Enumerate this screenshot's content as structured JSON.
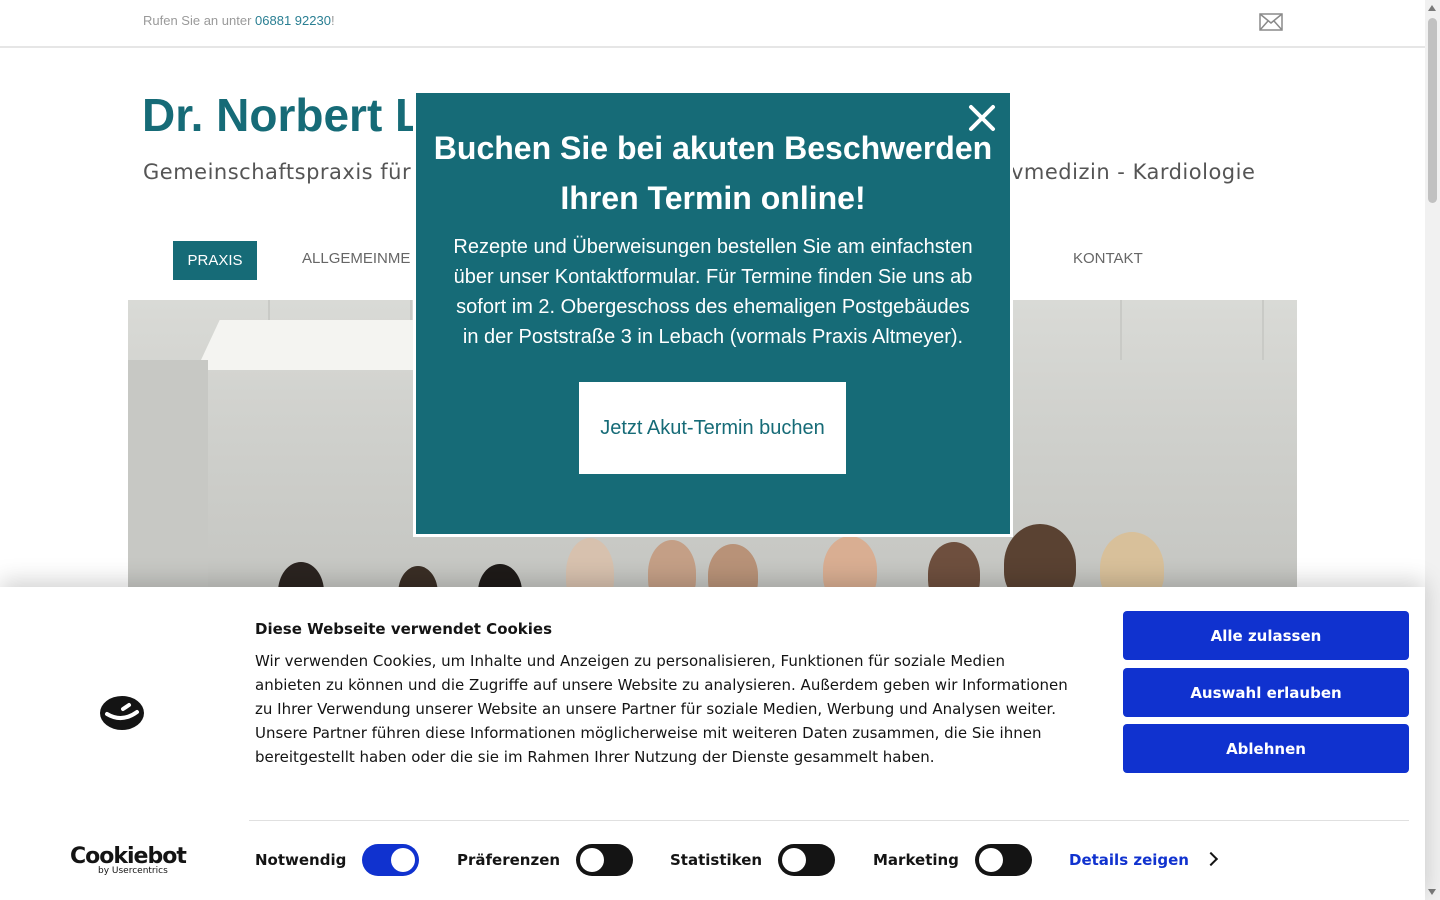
{
  "topbar": {
    "call_prefix": "Rufen Sie an unter ",
    "phone": "06881 92230",
    "call_suffix": "!",
    "mail_icon": "envelope-icon"
  },
  "site": {
    "title": "Dr. Norbert La",
    "subtitle_left": "Gemeinschaftspraxis für A",
    "subtitle_right": "vmedizin - Kardiologie"
  },
  "nav": {
    "items": [
      "PRAXIS",
      "ALLGEMEINME",
      "KONTAKT"
    ]
  },
  "popup": {
    "title": "Buchen Sie bei akuten Beschwerden Ihren Termin online!",
    "body": "Rezepte und Überweisungen bestellen Sie am einfachsten über unser Kontaktformular. Für Termine finden Sie uns ab sofort im 2. Obergeschoss des ehemaligen Postgebäudes in der Poststraße 3 in Lebach (vormals Praxis Altmeyer).",
    "button": "Jetzt Akut-Termin buchen",
    "close_icon": "close-icon"
  },
  "cookie": {
    "title": "Diese Webseite verwendet Cookies",
    "text": "Wir verwenden Cookies, um Inhalte und Anzeigen zu personalisieren, Funktionen für soziale Medien anbieten zu können und die Zugriffe auf unsere Website zu analysieren. Außerdem geben wir Informationen zu Ihrer Verwendung unserer Website an unsere Partner für soziale Medien, Werbung und Analysen weiter. Unsere Partner führen diese Informationen möglicherweise mit weiteren Daten zusammen, die Sie ihnen bereitgestellt haben oder die sie im Rahmen Ihrer Nutzung der Dienste gesammelt haben.",
    "buttons": [
      "Alle zulassen",
      "Auswahl erlauben",
      "Ablehnen"
    ],
    "toggles": [
      {
        "label": "Notwendig",
        "on": true
      },
      {
        "label": "Präferenzen",
        "on": false
      },
      {
        "label": "Statistiken",
        "on": false
      },
      {
        "label": "Marketing",
        "on": false
      }
    ],
    "details": "Details zeigen",
    "brand": "Cookiebot",
    "brand_sub": "by Usercentrics",
    "accent": "#1032cf"
  },
  "colors": {
    "teal": "#166b77"
  }
}
